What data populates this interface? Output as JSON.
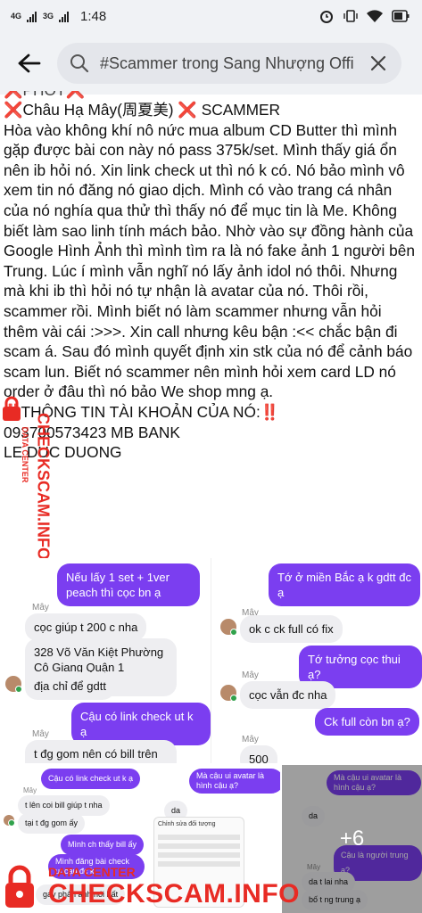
{
  "status": {
    "net1": "4G",
    "net2": "3G",
    "time": "1:48"
  },
  "search": {
    "query": "#Scammer trong Sang Nhượng Offi"
  },
  "post": {
    "header_partial": "❌PHỐT❌",
    "title_name": "Châu Hạ Mây(周夏美)",
    "title_tag": "SCAMMER",
    "body": "Hòa vào không khí nô nức mua album CD Butter thì mình gặp được bài con này nó pass 375k/set. Mình thấy giá ổn nên ib hỏi nó. Xin link check ut thì nó k có. Nó bảo mình vô xem tin nó đăng nó giao dịch. Mình có vào trang cá nhân của nó nghía qua thử thì thấy nó để mục tin là Me. Không biết làm sao linh tính mách bảo. Nhờ vào sự đồng hành của Google Hình Ảnh thì mình tìm ra là nó fake ảnh 1 người bên Trung. Lúc í mình vẫn nghĩ nó lấy ảnh idol nó thôi. Nhưng mà khi ib thì hỏi nó tự nhận là avatar của nó. Thôi rồi, scammer rồi. Mình biết nó làm scammer nhưng vẫn hỏi thêm vài cái :>>>. Xin call nhưng kêu bận :<< chắc bận đi scam á. Sau đó mình quyết định xin stk của nó để cảnh báo scam lun. Biết nó scammer nên mình hỏi xem card LD nó order ở đâu thì nó bảo We shop mng ạ.",
    "info_header": "THÔNG TIN TÀI KHOẢN CỦA NÓ:",
    "account": "093700573423 MB BANK",
    "owner": "LE DUC DUONG"
  },
  "images": {
    "a": {
      "msg1": "Nếu lấy 1 set + 1ver peach thì cọc bn ạ",
      "sender": "Mây",
      "msg2": "cọc giúp t 200 c nha",
      "msg3": "328 Võ Văn Kiệt Phường Cô Giang Quận 1 TPHCM",
      "msg4": "địa chỉ để gdtt",
      "msg5": "Cậu có link check ut k ạ",
      "sender2": "Mây",
      "msg6": "t đg gom nên có bill trên str"
    },
    "b": {
      "msg1": "Tớ ở miền Bắc ạ k gdtt đc ạ",
      "sender": "Mây",
      "msg2": "ok c ck full có fix",
      "msg3": "Tớ tưởng cọc thui ạ?",
      "sender2": "Mây",
      "msg4": "cọc vẫn đc nha",
      "msg5": "Ck full còn bn ạ?",
      "sender3": "Mây",
      "msg6": "500"
    },
    "c": {
      "msg1": "Cậu có link check ut k ạ",
      "sender": "Mây",
      "msg2": "t lên coi bill giúp t nha",
      "msg3": "tại t đg gom ấy",
      "msg4": "Mình ch thấy bill ấy",
      "msg5": "Mình đăng bài check ut cậu đc k",
      "msg6": "gay phản ánh nói bất",
      "msg7": "Mà cậu ui avatar là hình cậu ạ?",
      "msg8": "da",
      "msg9": "Chỉnh sửa đối tượng"
    },
    "d": {
      "msg1": "Mà cậu ui avatar là hình cậu ạ?",
      "msg2": "da",
      "msg3": "Cậu là người trung ạ?",
      "sender": "Mây",
      "msg4": "da t lai nha",
      "msg5": "bố t ng trung ạ",
      "more": "+6"
    }
  },
  "watermark": {
    "side_text": "CHECKSCAM.INFO",
    "side_small": "DATA CENTER",
    "bottom_small": "DATA CENTER",
    "bottom_text": "CHECKSCAM.INFO"
  },
  "colors": {
    "accent": "#7b3ef0",
    "scam_red": "#e0282a",
    "watermark": "#e82b24"
  }
}
